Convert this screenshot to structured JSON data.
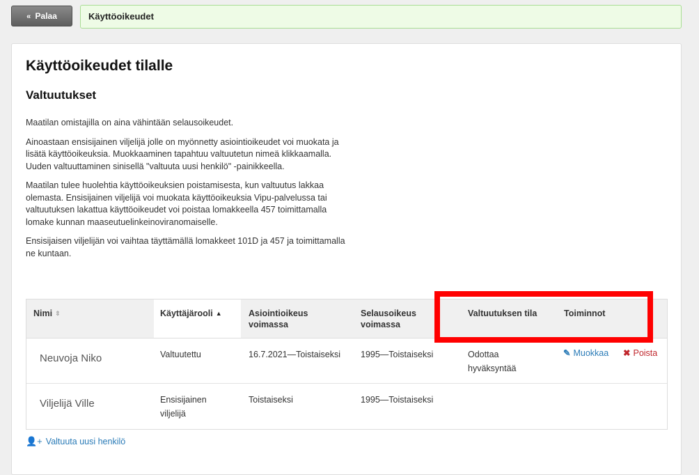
{
  "topbar": {
    "back_label": "Palaa",
    "breadcrumb": "Käyttöoikeudet"
  },
  "page": {
    "title": "Käyttöoikeudet tilalle",
    "section_title": "Valtuutukset",
    "paragraphs": [
      "Maatilan omistajilla on aina vähintään selausoikeudet.",
      "Ainoastaan ensisijainen viljelijä jolle on myönnetty asiointioikeudet voi muokata ja lisätä käyttöoikeuksia. Muokkaaminen tapahtuu valtuutetun nimeä klikkaamalla. Uuden valtuuttaminen sinisellä \"valtuuta uusi henkilö\" -painikkeella.",
      "Maatilan tulee huolehtia käyttöoikeuksien poistamisesta, kun valtuutus lakkaa olemasta. Ensisijainen viljelijä voi muokata käyttöoikeuksia Vipu-palvelussa tai valtuutuksen lakattua käyttöoikeudet voi poistaa lomakkeella 457 toimittamalla lomake kunnan maaseutuelinkeinoviranomaiselle.",
      "Ensisijaisen viljelijän voi vaihtaa täyttämällä lomakkeet 101D ja 457 ja toimittamalla ne kuntaan."
    ]
  },
  "table": {
    "headers": {
      "name": "Nimi",
      "role": "Käyttäjärooli",
      "transaction": "Asiointioikeus voimassa",
      "browse": "Selausoikeus voimassa",
      "status": "Valtuutuksen tila",
      "actions": "Toiminnot"
    },
    "rows": [
      {
        "name": "Neuvoja Niko",
        "role": "Valtuutettu",
        "transaction": "16.7.2021—Toistaiseksi",
        "browse": "1995—Toistaiseksi",
        "status": "Odottaa hyväksyntää",
        "edit_label": "Muokkaa",
        "delete_label": "Poista"
      },
      {
        "name": "Viljelijä Ville",
        "role": "Ensisijainen viljelijä",
        "transaction": "Toistaiseksi",
        "browse": "1995—Toistaiseksi",
        "status": ""
      }
    ]
  },
  "add_user_label": "Valtuuta uusi henkilö",
  "icons": {
    "back": "double-chevron-left-icon",
    "sort": "sort-icon",
    "sort_asc": "sort-asc-icon",
    "edit": "edit-icon",
    "delete": "times-icon",
    "add_user": "user-plus-icon"
  },
  "colors": {
    "link": "#2a7bb7",
    "danger": "#c0262c",
    "highlight": "#ff0000",
    "breadcrumb_bg": "#eefbe6"
  }
}
